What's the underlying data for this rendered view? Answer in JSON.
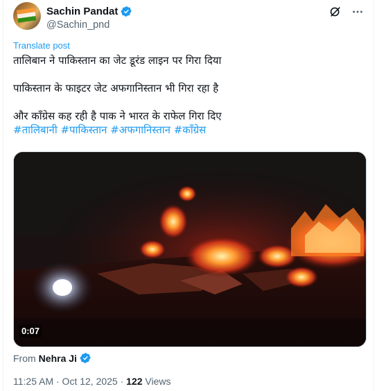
{
  "author": {
    "name": "Sachin Pandat",
    "handle": "@Sachin_pnd"
  },
  "translate_link": "Translate post",
  "post": {
    "line1": "तालिबान ने पाकिस्तान का जेट डूरंड लाइन पर गिरा दिया",
    "line2": "पाकिस्तान के फाइटर जेट अफगानिस्तान भी गिरा रहा है",
    "line3": "और कॉंग्रेस कह रही है पाक ने भारत के राफेल गिरा दिए",
    "hashtags": "#तालिबानी #पाकिस्तान #अफगानिस्तान #कॉंग्रेस"
  },
  "media": {
    "duration": "0:07"
  },
  "source": {
    "prefix": "From",
    "name": "Nehra Ji"
  },
  "meta": {
    "timestamp": "11:25 AM · Oct 12, 2025 · ",
    "views_count": "122",
    "views_label": " Views"
  },
  "colors": {
    "accent": "#1d9bf0",
    "text": "#0f1419",
    "muted": "#536471"
  },
  "icons": {
    "verified": "verified-badge-icon",
    "grok": "grok-icon",
    "more": "more-icon"
  }
}
